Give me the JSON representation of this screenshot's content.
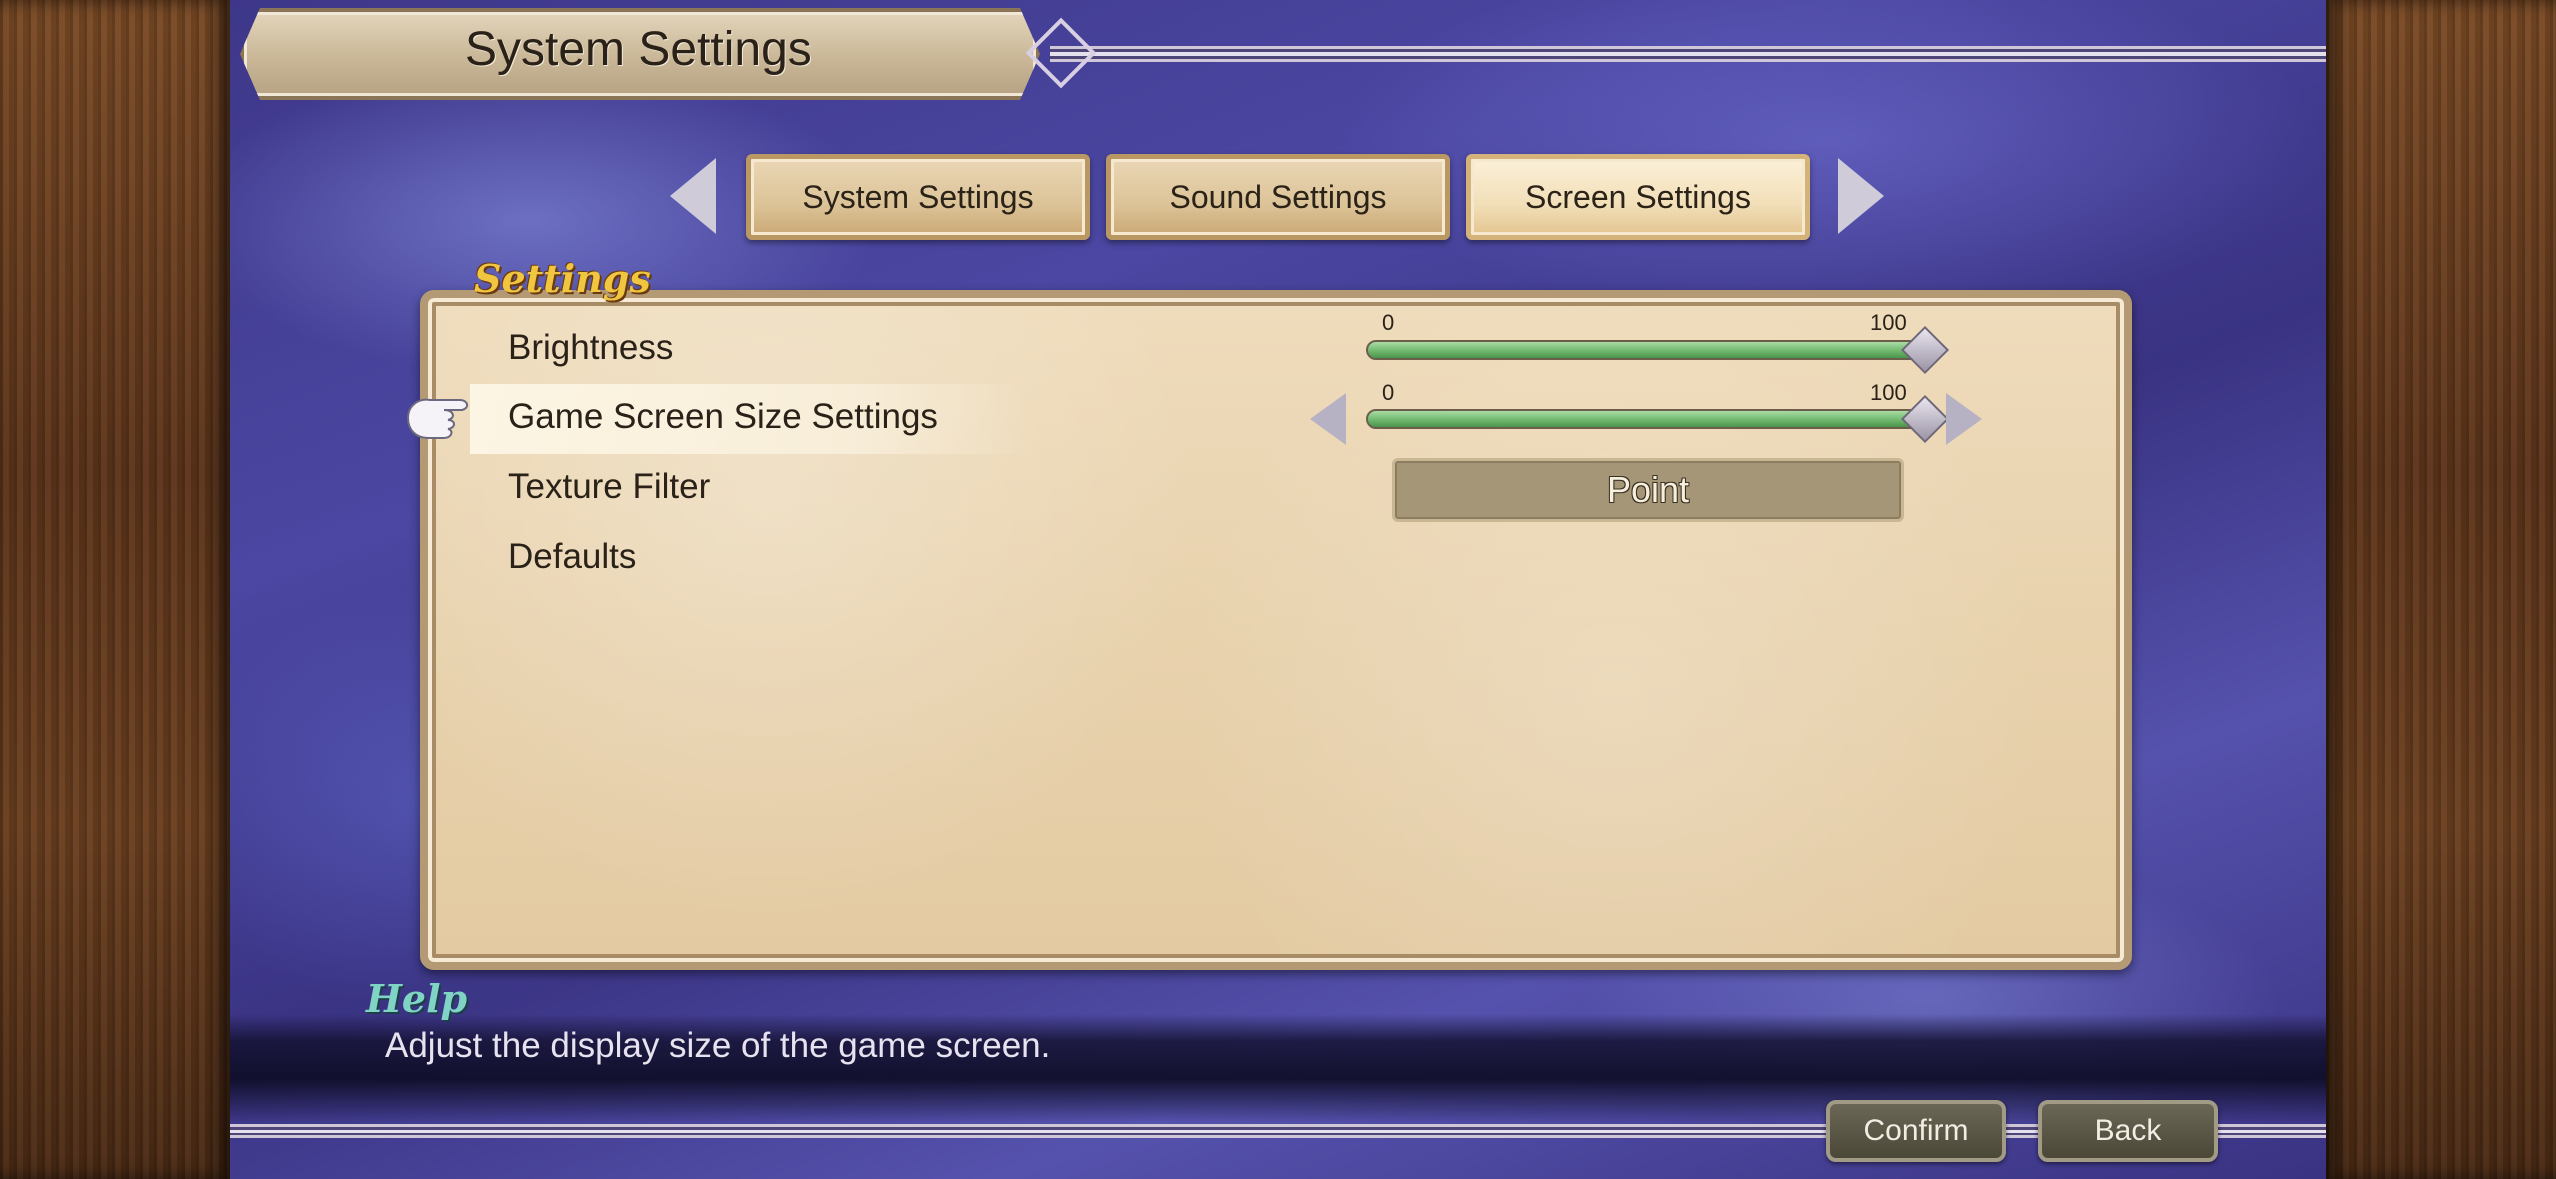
{
  "header": {
    "title": "System Settings"
  },
  "tabs": [
    {
      "label": "System Settings",
      "active": false
    },
    {
      "label": "Sound Settings",
      "active": false
    },
    {
      "label": "Screen Settings",
      "active": true
    }
  ],
  "section": {
    "label": "Settings"
  },
  "settings": [
    {
      "label": "Brightness",
      "type": "slider",
      "min": "0",
      "max": "100",
      "value": 100
    },
    {
      "label": "Game Screen Size Settings",
      "type": "slider",
      "min": "0",
      "max": "100",
      "value": 100,
      "selected": true
    },
    {
      "label": "Texture Filter",
      "type": "select",
      "value": "Point"
    },
    {
      "label": "Defaults",
      "type": "action"
    }
  ],
  "help": {
    "label": "Help",
    "text": "Adjust the display size of the game screen."
  },
  "footer": {
    "confirm_label": "Confirm",
    "back_label": "Back"
  },
  "colors": {
    "slider_fill": "#6bb56a",
    "section_label": "#f0c640",
    "help_label": "#7fd4c6"
  },
  "icons": [
    "left-arrow-icon",
    "right-arrow-icon",
    "pointing-hand-icon",
    "slider-knob-icon"
  ]
}
